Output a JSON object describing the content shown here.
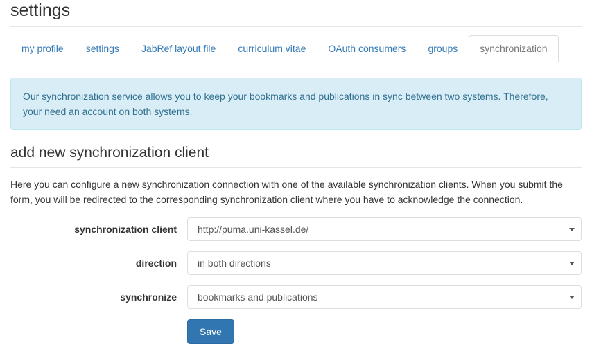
{
  "header": {
    "title": "settings"
  },
  "tabs": [
    {
      "label": "my profile",
      "active": false
    },
    {
      "label": "settings",
      "active": false
    },
    {
      "label": "JabRef layout file",
      "active": false
    },
    {
      "label": "curriculum vitae",
      "active": false
    },
    {
      "label": "OAuth consumers",
      "active": false
    },
    {
      "label": "groups",
      "active": false
    },
    {
      "label": "synchronization",
      "active": true
    }
  ],
  "alert": {
    "text": "Our synchronization service allows you to keep your bookmarks and publications in sync between two systems. Therefore, your need an account on both systems."
  },
  "section": {
    "title": "add new synchronization client",
    "description": "Here you can configure a new synchronization connection with one of the available synchronization clients. When you submit the form, you will be redirected to the corresponding synchronization client where you have to acknowledge the connection."
  },
  "form": {
    "fields": [
      {
        "label": "synchronization client",
        "value": "http://puma.uni-kassel.de/",
        "caret": "chevron-down-icon"
      },
      {
        "label": "direction",
        "value": "in both directions",
        "caret": "chevron-down-icon"
      },
      {
        "label": "synchronize",
        "value": "bookmarks and publications",
        "caret": "chevron-down-icon"
      }
    ],
    "save_label": "Save"
  },
  "colors": {
    "link": "#337ab7",
    "alert_bg": "#d9edf7",
    "alert_border": "#bce8f1",
    "alert_text": "#31708f",
    "primary_button": "#3276b1",
    "border": "#dddddd"
  }
}
